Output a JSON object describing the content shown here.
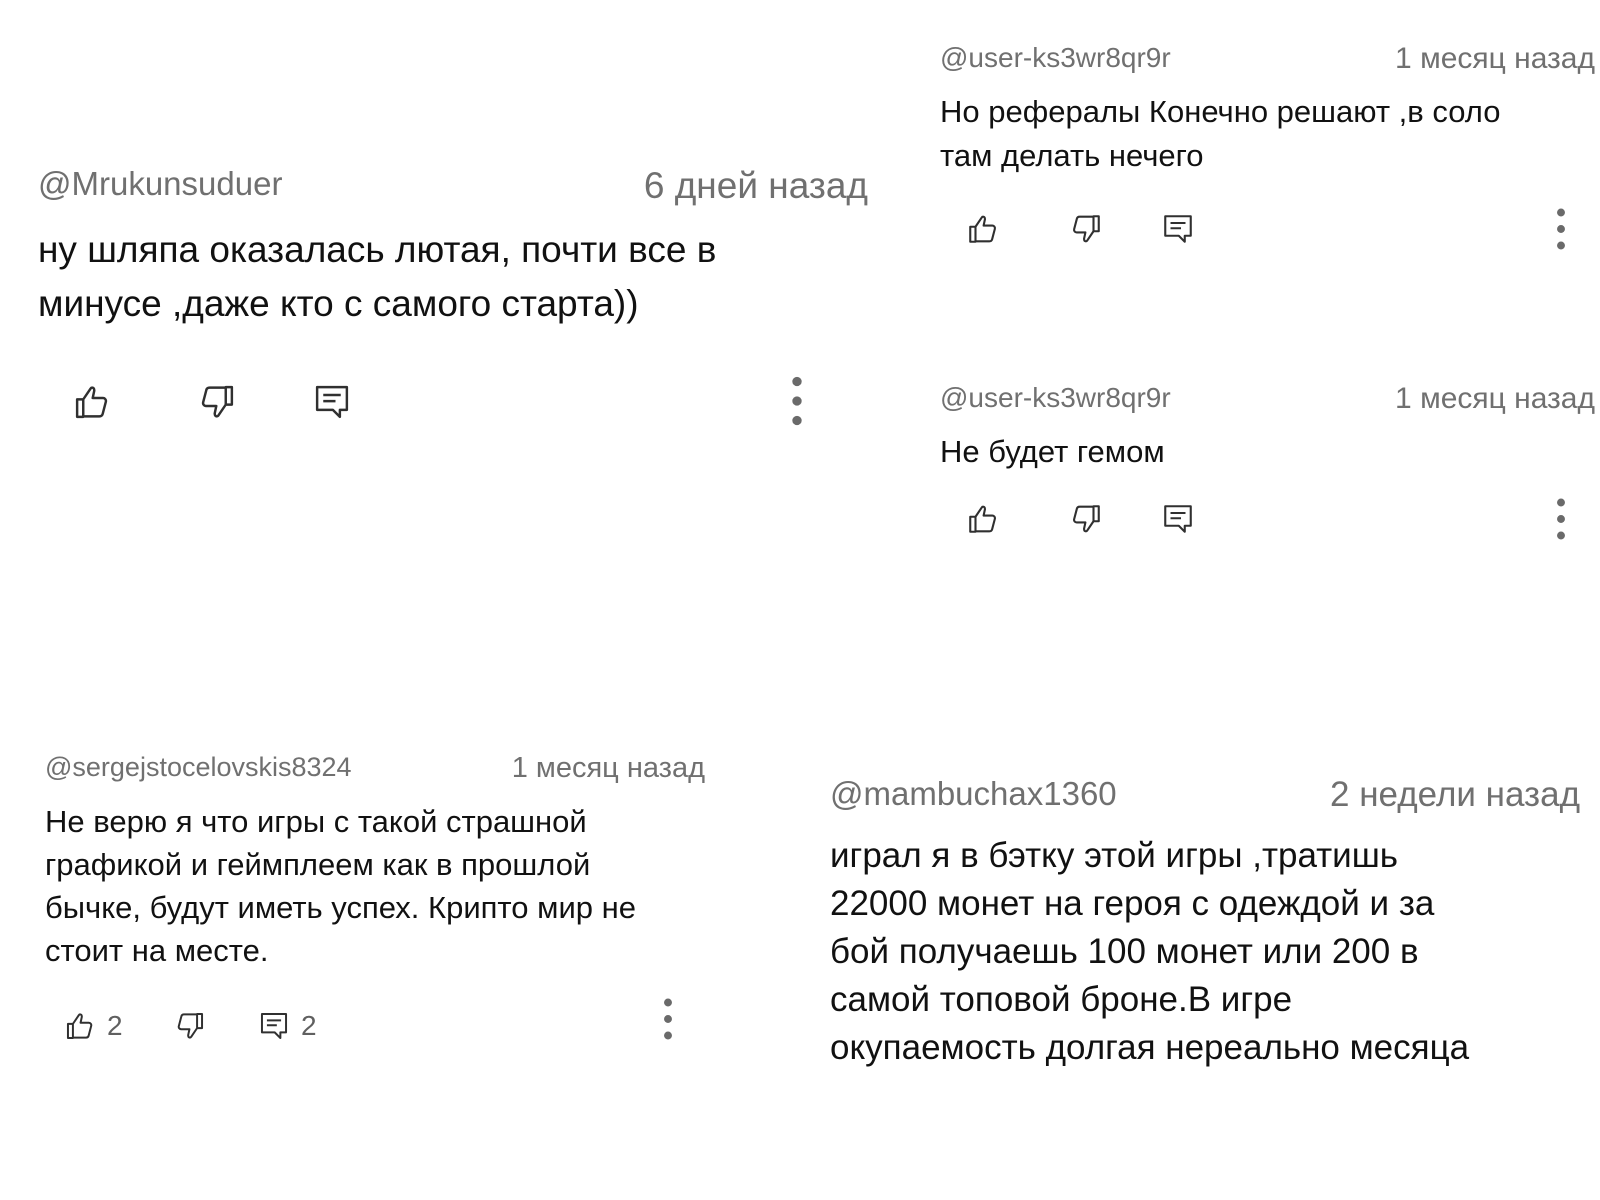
{
  "comments": [
    {
      "author": "@Mrukunsuduer",
      "time": "6 дней назад",
      "text_lines": [
        "ну шляпа оказалась лютая, почти все в",
        "минусе ,даже кто с самого старта))"
      ]
    },
    {
      "author": "@user-ks3wr8qr9r",
      "time": "1 месяц назад",
      "text_lines": [
        "Но рефералы Конечно решают ,в соло",
        "там делать нечего"
      ]
    },
    {
      "author": "@user-ks3wr8qr9r",
      "time": "1 месяц назад",
      "text_lines": [
        "Не будет гемом"
      ]
    },
    {
      "author": "@sergejstocelovskis8324",
      "time": "1 месяц назад",
      "text_lines": [
        "Не верю я что игры с такой страшной",
        "графикой и геймплеем как в прошлой",
        "бычке, будут иметь успех. Крипто мир не",
        "стоит на месте."
      ],
      "like_count": "2",
      "reply_count": "2"
    },
    {
      "author": "@mambuchax1360",
      "time": "2 недели назад",
      "text_lines": [
        "играл я в бэтку этой игры ,тратишь",
        "22000 монет на героя с одеждой и за",
        "бой получаешь 100 монет или 200 в",
        "самой топовой броне.В игре",
        "окупаемость долгая нереально месяца"
      ]
    }
  ]
}
